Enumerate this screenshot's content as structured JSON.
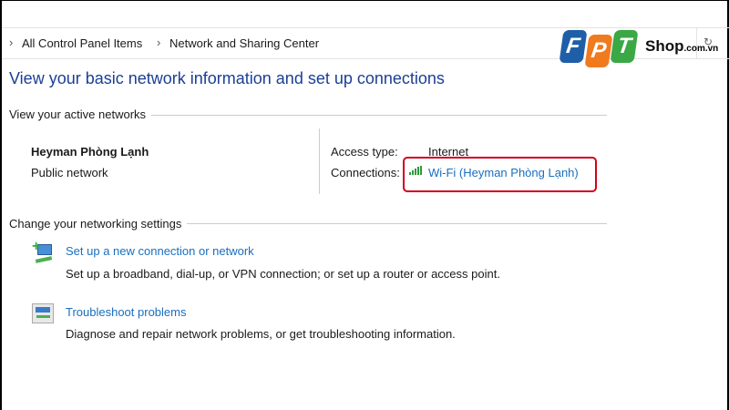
{
  "breadcrumb": {
    "items": [
      "All Control Panel Items",
      "Network and Sharing Center"
    ]
  },
  "logo": {
    "letters": [
      "F",
      "P",
      "T"
    ],
    "suffix": "Shop",
    "domain": ".com.vn",
    "colors": [
      "#1f5fa8",
      "#f07a1e",
      "#3aa845"
    ]
  },
  "page_title": "View your basic network information and set up connections",
  "active_networks": {
    "heading": "View your active networks",
    "name": "Heyman Phòng Lạnh",
    "type": "Public network",
    "access_label": "Access type:",
    "access_value": "Internet",
    "connections_label": "Connections:",
    "connection_link": "Wi-Fi (Heyman Phòng Lạnh)"
  },
  "settings": {
    "heading": "Change your networking settings",
    "items": [
      {
        "title": "Set up a new connection or network",
        "desc": "Set up a broadband, dial-up, or VPN connection; or set up a router or access point."
      },
      {
        "title": "Troubleshoot problems",
        "desc": "Diagnose and repair network problems, or get troubleshooting information."
      }
    ]
  },
  "highlight_color": "#d0021b"
}
